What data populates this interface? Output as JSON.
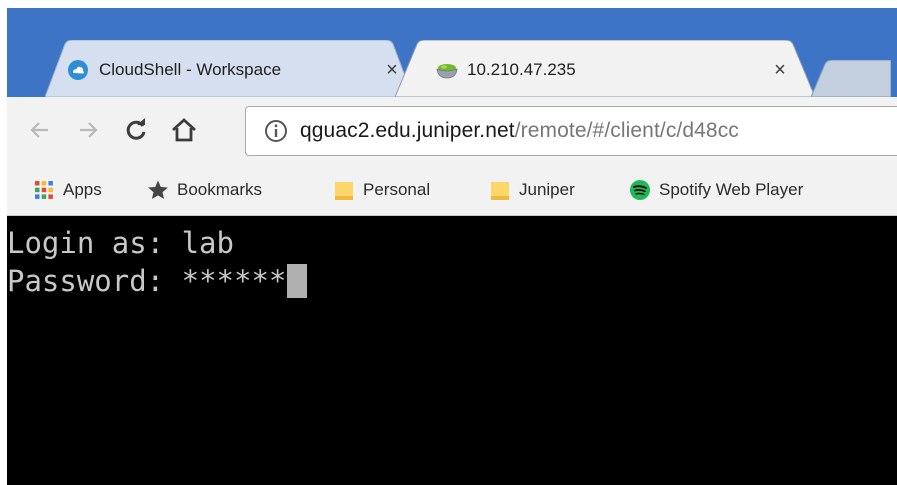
{
  "tabs": [
    {
      "title": "CloudShell - Workspace",
      "close": "×",
      "favicon": "cloud-icon",
      "active": false
    },
    {
      "title": "10.210.47.235",
      "close": "×",
      "favicon": "guacamole-bowl-icon",
      "active": true
    }
  ],
  "toolbar": {
    "back": "back-arrow-icon",
    "forward": "forward-arrow-icon",
    "reload": "reload-icon",
    "home": "home-icon",
    "info": "info-icon",
    "url_host": "qguac2.edu.juniper.net",
    "url_path": "/remote/#/client/c/d48cc"
  },
  "bookmarks": [
    {
      "label": "Apps",
      "icon": "apps-grid-icon"
    },
    {
      "label": "Bookmarks",
      "icon": "star-icon"
    },
    {
      "label": "Personal",
      "icon": "folder-icon"
    },
    {
      "label": "Juniper",
      "icon": "folder-icon"
    },
    {
      "label": "Spotify Web Player",
      "icon": "spotify-icon"
    }
  ],
  "terminal": {
    "line1": "Login as: lab",
    "line2_prompt": "Password: ",
    "line2_value": "******"
  },
  "colors": {
    "frame": "#3d74c6",
    "toolbar": "#f2f2f2",
    "terminal_bg": "#000000",
    "terminal_text": "#c8c8c8"
  }
}
